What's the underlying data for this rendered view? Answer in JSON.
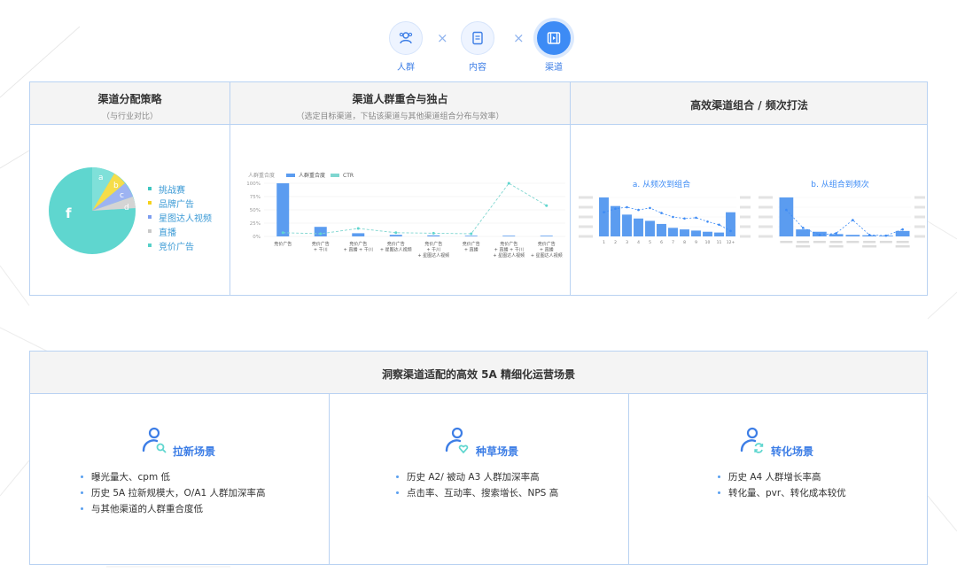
{
  "steps": [
    {
      "label": "人群",
      "icon": "people-icon"
    },
    {
      "label": "内容",
      "icon": "content-icon"
    },
    {
      "label": "渠道",
      "icon": "channel-icon"
    }
  ],
  "step_separator": "×",
  "panels": {
    "strategy": {
      "title": "渠道分配策略",
      "subtitle": "（与行业对比）"
    },
    "overlap": {
      "title": "渠道人群重合与独占",
      "subtitle": "（选定目标渠道，下钻该渠道与其他渠道组合分布与效率）"
    },
    "combo": {
      "title": "高效渠道组合 / 频次打法"
    }
  },
  "pie": {
    "labels": [
      "a",
      "b",
      "c",
      "d",
      "f"
    ],
    "legend": [
      "挑战赛",
      "品牌广告",
      "星图达人视频",
      "直播",
      "竞价广告"
    ],
    "legend_colors": [
      "#3ec6c0",
      "#f5d21c",
      "#7e9ef0",
      "#c9c9c9",
      "#57d0c8"
    ]
  },
  "chart_data": [
    {
      "type": "bar",
      "title": "",
      "ylabel": "人群重合度",
      "series": [
        {
          "name": "人群重合度",
          "values": [
            100,
            18,
            6,
            3,
            2,
            1,
            0,
            0
          ]
        },
        {
          "name": "CTR",
          "values": [
            7,
            5,
            15,
            7,
            6,
            5,
            100,
            58
          ]
        }
      ],
      "categories": [
        "竞价广告",
        "竞价广告+千川",
        "竞价广告+直播+千川",
        "竞价广告+星图达人视频",
        "竞价广告+千川+星图达人视频",
        "竞价广告+直播",
        "竞价广告+直播+千川+星图达人视频",
        "竞价广告+直播+星图达人视频"
      ],
      "category_lines": [
        [
          "竞价广告"
        ],
        [
          "竞价广告",
          "+ 千川"
        ],
        [
          "竞价广告",
          "+ 直播 + 千川"
        ],
        [
          "竞价广告",
          "+ 星图达人视频"
        ],
        [
          "竞价广告",
          "+ 千川",
          "+ 星图达人视频"
        ],
        [
          "竞价广告",
          "+ 直播"
        ],
        [
          "竞价广告",
          "+ 直播 + 千川",
          "+ 星图达人视频"
        ],
        [
          "竞价广告",
          "+ 直播",
          "+ 星图达人视频"
        ]
      ],
      "yticks": [
        "100%",
        "75%",
        "50%",
        "25%",
        "0%"
      ],
      "ylim": [
        0,
        100
      ],
      "legend": "top-left"
    },
    {
      "type": "bar",
      "title": "a. 从频次到组合",
      "categories": [
        "1",
        "2",
        "3",
        "4",
        "5",
        "6",
        "7",
        "8",
        "9",
        "10",
        "11",
        "12+"
      ],
      "series": [
        {
          "values": [
            100,
            78,
            56,
            46,
            40,
            32,
            22,
            18,
            15,
            12,
            10,
            62
          ]
        },
        {
          "values": [
            62,
            71,
            75,
            68,
            73,
            60,
            50,
            46,
            48,
            38,
            30,
            14
          ]
        }
      ],
      "ylim": [
        0,
        100
      ]
    },
    {
      "type": "bar",
      "title": "b. 从组合到频次",
      "categories": [
        "",
        "",
        "",
        "",
        "",
        "",
        "",
        ""
      ],
      "series": [
        {
          "values": [
            100,
            18,
            12,
            6,
            4,
            3,
            2,
            14
          ]
        },
        {
          "values": [
            68,
            22,
            4,
            8,
            42,
            4,
            2,
            18
          ]
        }
      ],
      "ylim": [
        0,
        100
      ]
    }
  ],
  "insight": {
    "title": "洞察渠道适配的高效 5A 精细化运营场景",
    "scenes": [
      {
        "title": "拉新场景",
        "icon": "search-person-icon",
        "bullets": [
          "曝光量大、cpm 低",
          "历史 5A 拉新规模大，O/A1 人群加深率高",
          "与其他渠道的人群重合度低"
        ]
      },
      {
        "title": "种草场景",
        "icon": "heart-person-icon",
        "bullets": [
          "历史 A2/ 被动 A3 人群加深率高",
          "点击率、互动率、搜索增长、NPS 高"
        ]
      },
      {
        "title": "转化场景",
        "icon": "refresh-person-icon",
        "bullets": [
          "历史 A4 人群增长率高",
          "转化量、pvr、转化成本较优"
        ]
      }
    ]
  },
  "colors": {
    "primary": "#3d8bf5",
    "accent": "#3d7ee6",
    "border": "#b9d2f2",
    "teal": "#5fd6cf",
    "bar": "#5b9cf0"
  }
}
